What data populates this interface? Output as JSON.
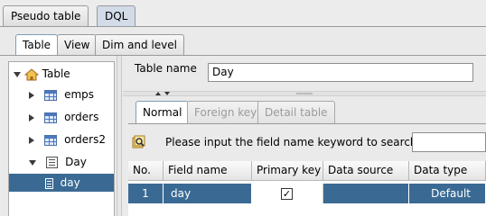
{
  "top_tabs": [
    {
      "label": "Pseudo table",
      "active": false
    },
    {
      "label": "DQL",
      "active": true
    }
  ],
  "sub_tabs": [
    {
      "label": "Table",
      "active": true
    },
    {
      "label": "View",
      "active": false
    },
    {
      "label": "Dim and level",
      "active": false
    }
  ],
  "tree": {
    "root": "Table",
    "items": [
      {
        "label": "emps",
        "icon": "table-icon",
        "expanded": false
      },
      {
        "label": "orders",
        "icon": "table-icon",
        "expanded": false
      },
      {
        "label": "orders2",
        "icon": "table-icon",
        "expanded": false
      },
      {
        "label": "Day",
        "icon": "document-icon",
        "expanded": true
      }
    ],
    "leaf": {
      "label": "day",
      "selected": true
    }
  },
  "table_name": {
    "label": "Table name",
    "value": "Day"
  },
  "inner_tabs": [
    {
      "label": "Normal",
      "active": true
    },
    {
      "label": "Foreign key",
      "active": false
    },
    {
      "label": "Detail table",
      "active": false
    }
  ],
  "search": {
    "prompt": "Please input the field name keyword to search:",
    "value": ""
  },
  "grid": {
    "columns": [
      "No.",
      "Field name",
      "Primary key",
      "Data source",
      "Data type"
    ],
    "rows": [
      {
        "no": "1",
        "field_name": "day",
        "primary_key": true,
        "data_source": "",
        "data_type": "Default"
      }
    ]
  },
  "colors": {
    "selection": "#3a6a94",
    "accent_tab": "#d2dbe8"
  }
}
